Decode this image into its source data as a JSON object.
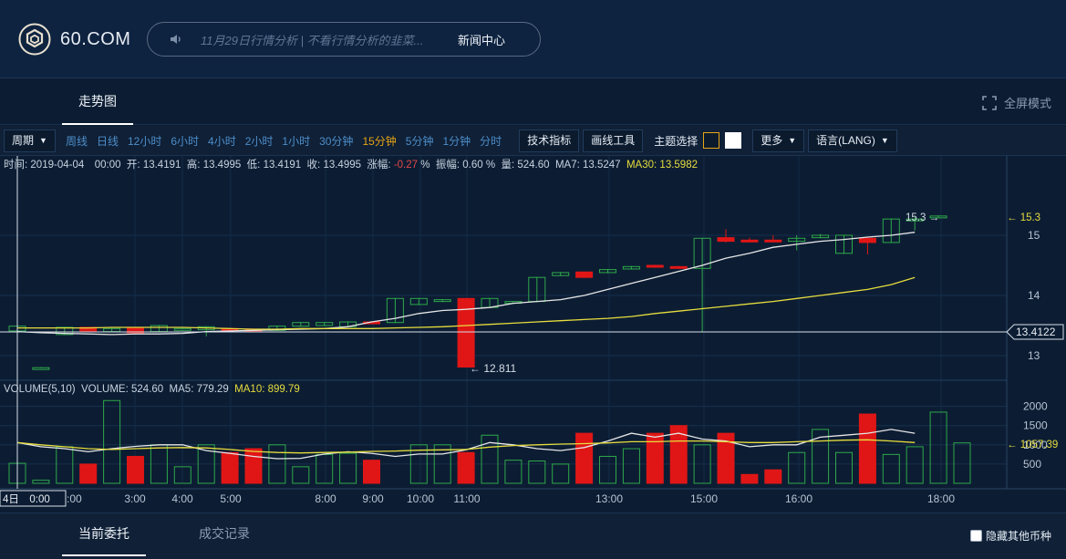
{
  "header": {
    "logo_text": "60.COM",
    "news_headline": "11月29日行情分析 | 不看行情分析的韭菜...",
    "news_center": "新闻中心"
  },
  "tabs": {
    "trend": "走势图",
    "fullscreen": "全屏模式"
  },
  "toolbar": {
    "period_dropdown": "周期",
    "periods": [
      "周线",
      "日线",
      "12小时",
      "6小时",
      "4小时",
      "2小时",
      "1小时",
      "30分钟",
      "15分钟",
      "5分钟",
      "1分钟",
      "分时"
    ],
    "active_period": "15分钟",
    "indicators": "技术指标",
    "drawing_tools": "画线工具",
    "theme_label": "主题选择",
    "more": "更多",
    "language": "语言(LANG)"
  },
  "info": {
    "time_label": "时间:",
    "time": "2019-04-04　00:00",
    "open_label": "开:",
    "open": "13.4191",
    "high_label": "高:",
    "high": "13.4995",
    "low_label": "低:",
    "low": "13.4191",
    "close_label": "收:",
    "close": "13.4995",
    "change_label": "涨幅:",
    "change": "-0.27",
    "change_unit": "%",
    "amp_label": "振幅:",
    "amp": "0.60 %",
    "vol_label": "量:",
    "vol": "524.60",
    "ma7_label": "MA7:",
    "ma7": "13.5247",
    "ma30_label": "MA30:",
    "ma30": "13.5982"
  },
  "volume_info": {
    "title": "VOLUME(5,10)",
    "vol_label": "VOLUME:",
    "vol": "524.60",
    "ma5_label": "MA5:",
    "ma5": "779.29",
    "ma10_label": "MA10:",
    "ma10": "899.79"
  },
  "chart_data": {
    "type": "candlestick",
    "price_ticks": [
      "15",
      "14",
      "13"
    ],
    "volume_ticks": [
      "2000",
      "1500",
      "1000",
      "500"
    ],
    "time_ticks": [
      "3:00",
      "4:00",
      "5:00",
      "8:00",
      "9:00",
      "10:00",
      "11:00",
      "13:00",
      "15:00",
      "16:00",
      "18:00"
    ],
    "crosshair_price": "13.4122",
    "crosshair_time": "4日　0:00",
    "crosshair_time_partial": ":00",
    "last_price_label": "15.3",
    "last_price_axis": "15.3",
    "min_price_label": "12.811",
    "last_volume_axis": "1057.39",
    "colors": {
      "up": "#2ea84a",
      "down": "#e01616",
      "ma_short": "#e6e6e6",
      "ma_long": "#e7dd3e"
    },
    "candles": [
      {
        "o": 13.41,
        "c": 13.49,
        "h": 13.5,
        "l": 13.4
      },
      {
        "o": 12.8,
        "c": 12.8,
        "h": 12.81,
        "l": 12.79
      },
      {
        "o": 13.35,
        "c": 13.47,
        "h": 13.48,
        "l": 13.34
      },
      {
        "o": 13.47,
        "c": 13.41,
        "h": 13.48,
        "l": 13.4
      },
      {
        "o": 13.4,
        "c": 13.45,
        "h": 13.46,
        "l": 13.39
      },
      {
        "o": 13.47,
        "c": 13.38,
        "h": 13.48,
        "l": 13.37
      },
      {
        "o": 13.4,
        "c": 13.5,
        "h": 13.51,
        "l": 13.39
      },
      {
        "o": 13.45,
        "c": 13.45,
        "h": 13.46,
        "l": 13.44
      },
      {
        "o": 13.43,
        "c": 13.48,
        "h": 13.49,
        "l": 13.32
      },
      {
        "o": 13.45,
        "c": 13.42,
        "h": 13.46,
        "l": 13.41
      },
      {
        "o": 13.44,
        "c": 13.42,
        "h": 13.45,
        "l": 13.41
      },
      {
        "o": 13.42,
        "c": 13.49,
        "h": 13.5,
        "l": 13.41
      },
      {
        "o": 13.49,
        "c": 13.55,
        "h": 13.56,
        "l": 13.48
      },
      {
        "o": 13.5,
        "c": 13.55,
        "h": 13.56,
        "l": 13.49
      },
      {
        "o": 13.48,
        "c": 13.56,
        "h": 13.57,
        "l": 13.47
      },
      {
        "o": 13.56,
        "c": 13.53,
        "h": 13.57,
        "l": 13.52
      },
      {
        "o": 13.55,
        "c": 13.95,
        "h": 13.96,
        "l": 13.54
      },
      {
        "o": 13.85,
        "c": 13.95,
        "h": 13.96,
        "l": 13.84
      },
      {
        "o": 13.9,
        "c": 13.93,
        "h": 13.94,
        "l": 13.89
      },
      {
        "o": 13.95,
        "c": 12.81,
        "h": 13.95,
        "l": 12.81
      },
      {
        "o": 13.8,
        "c": 13.95,
        "h": 13.96,
        "l": 13.79
      },
      {
        "o": 13.88,
        "c": 13.9,
        "h": 13.91,
        "l": 13.87
      },
      {
        "o": 13.9,
        "c": 14.3,
        "h": 14.31,
        "l": 13.89
      },
      {
        "o": 14.33,
        "c": 14.38,
        "h": 14.39,
        "l": 14.32
      },
      {
        "o": 14.39,
        "c": 14.3,
        "h": 14.4,
        "l": 14.29
      },
      {
        "o": 14.38,
        "c": 14.43,
        "h": 14.44,
        "l": 14.37
      },
      {
        "o": 14.44,
        "c": 14.48,
        "h": 14.49,
        "l": 14.43
      },
      {
        "o": 14.5,
        "c": 14.47,
        "h": 14.51,
        "l": 14.46
      },
      {
        "o": 14.48,
        "c": 14.45,
        "h": 14.49,
        "l": 14.44
      },
      {
        "o": 14.45,
        "c": 14.95,
        "h": 14.96,
        "l": 13.4
      },
      {
        "o": 14.96,
        "c": 14.9,
        "h": 15.1,
        "l": 14.88
      },
      {
        "o": 14.92,
        "c": 14.9,
        "h": 14.96,
        "l": 14.88
      },
      {
        "o": 14.92,
        "c": 14.9,
        "h": 15.0,
        "l": 14.88
      },
      {
        "o": 14.9,
        "c": 14.95,
        "h": 15.0,
        "l": 14.75
      },
      {
        "o": 14.96,
        "c": 15.0,
        "h": 15.02,
        "l": 14.95
      },
      {
        "o": 14.7,
        "c": 15.0,
        "h": 15.01,
        "l": 14.69
      },
      {
        "o": 14.95,
        "c": 14.88,
        "h": 14.97,
        "l": 14.68
      },
      {
        "o": 14.88,
        "c": 15.27,
        "h": 15.28,
        "l": 14.87
      },
      {
        "o": 15.27,
        "c": 15.27,
        "h": 15.3,
        "l": 15.08
      },
      {
        "o": 15.3,
        "c": 15.32,
        "h": 15.33,
        "l": 15.29
      }
    ],
    "volumes": [
      520,
      80,
      950,
      500,
      2150,
      700,
      1000,
      430,
      1000,
      800,
      900,
      1000,
      430,
      750,
      780,
      600,
      0,
      1000,
      1000,
      800,
      1250,
      600,
      580,
      500,
      1300,
      700,
      900,
      1300,
      1500,
      1000,
      1300,
      230,
      350,
      800,
      1400,
      800,
      1800,
      750,
      950,
      1850,
      1050
    ],
    "ma_short": [
      13.4,
      13.38,
      13.37,
      13.36,
      13.35,
      13.36,
      13.36,
      13.37,
      13.4,
      13.41,
      13.42,
      13.43,
      13.44,
      13.45,
      13.48,
      13.56,
      13.62,
      13.7,
      13.75,
      13.77,
      13.8,
      13.87,
      13.9,
      13.93,
      14.0,
      14.1,
      14.2,
      14.3,
      14.4,
      14.5,
      14.62,
      14.7,
      14.8,
      14.85,
      14.9,
      14.93,
      14.97,
      15.0,
      15.05
    ],
    "ma_long": [
      13.46,
      13.46,
      13.46,
      13.46,
      13.47,
      13.47,
      13.47,
      13.47,
      13.46,
      13.45,
      13.44,
      13.44,
      13.45,
      13.45,
      13.45,
      13.45,
      13.46,
      13.47,
      13.48,
      13.5,
      13.52,
      13.54,
      13.56,
      13.58,
      13.6,
      13.62,
      13.65,
      13.7,
      13.74,
      13.78,
      13.82,
      13.86,
      13.9,
      13.95,
      14.0,
      14.05,
      14.1,
      14.18,
      14.3
    ],
    "vol_ma5": [
      1060,
      950,
      900,
      820,
      900,
      960,
      1000,
      1000,
      850,
      780,
      700,
      640,
      650,
      760,
      820,
      780,
      700,
      760,
      760,
      870,
      1060,
      1000,
      900,
      850,
      930,
      1100,
      1300,
      1200,
      1300,
      1150,
      1100,
      950,
      1000,
      1000,
      1200,
      1250,
      1300,
      1400,
      1300
    ],
    "vol_ma10": [
      1060,
      1000,
      950,
      900,
      880,
      900,
      920,
      930,
      920,
      880,
      830,
      800,
      790,
      800,
      810,
      830,
      840,
      860,
      870,
      880,
      940,
      980,
      1000,
      1020,
      1030,
      1050,
      1080,
      1080,
      1100,
      1100,
      1080,
      1060,
      1060,
      1080,
      1100,
      1120,
      1130,
      1100,
      1060
    ]
  },
  "bottom": {
    "tab_orders": "当前委托",
    "tab_trades": "成交记录",
    "hide_other": "隐藏其他币种"
  }
}
